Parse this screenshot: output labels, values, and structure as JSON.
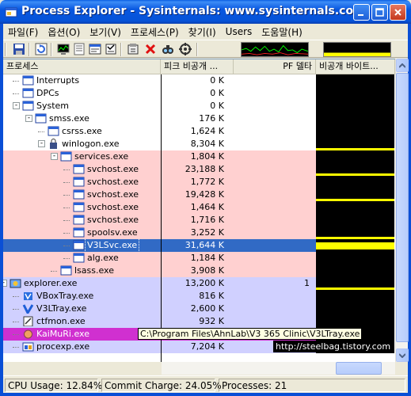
{
  "window": {
    "title": "Process Explorer - Sysinternals: www.sysinternals.co...",
    "colors": {
      "titlebar": "#0857e0",
      "service_row": "#ffd0d0",
      "own_row": "#d0d0ff",
      "selected_row": "#316ac5",
      "highlight_row": "#d030d0",
      "graph_fill": "#ffff00"
    }
  },
  "menu": [
    "파일(F)",
    "옵션(O)",
    "보기(V)",
    "프로세스(P)",
    "찾기(I)",
    "Users",
    "도움말(H)"
  ],
  "toolbar": {
    "icons": [
      "save-icon",
      "refresh-icon",
      "system-info-icon",
      "dll-view-icon",
      "window-icon",
      "properties-icon",
      "target-icon",
      "kill-icon",
      "find-icon",
      "crosshair-icon"
    ]
  },
  "columns": {
    "name": "프로세스",
    "peak": "피크 비공개 ...",
    "pf": "PF 델타",
    "private_graph": "비공개 바이트..."
  },
  "rows": [
    {
      "name": "Interrupts",
      "peak": "0 K",
      "pf": "",
      "level": 1,
      "expander": "",
      "bg": "#ffffff",
      "icon": "window",
      "bar": 0
    },
    {
      "name": "DPCs",
      "peak": "0 K",
      "pf": "",
      "level": 1,
      "expander": "",
      "bg": "#ffffff",
      "icon": "window",
      "bar": 0
    },
    {
      "name": "System",
      "peak": "0 K",
      "pf": "",
      "level": 1,
      "expander": "-",
      "bg": "#ffffff",
      "icon": "window",
      "bar": 0
    },
    {
      "name": "smss.exe",
      "peak": "176 K",
      "pf": "",
      "level": 2,
      "expander": "-",
      "bg": "#ffffff",
      "icon": "window",
      "bar": 0
    },
    {
      "name": "csrss.exe",
      "peak": "1,624 K",
      "pf": "",
      "level": 3,
      "expander": "",
      "bg": "#ffffff",
      "icon": "window",
      "bar": 0
    },
    {
      "name": "winlogon.exe",
      "peak": "8,304 K",
      "pf": "",
      "level": 3,
      "expander": "-",
      "bg": "#ffffff",
      "icon": "lock",
      "bar": 1
    },
    {
      "name": "services.exe",
      "peak": "1,804 K",
      "pf": "",
      "level": 4,
      "expander": "-",
      "bg": "#ffd0d0",
      "icon": "window",
      "bar": 0
    },
    {
      "name": "svchost.exe",
      "peak": "23,188 K",
      "pf": "",
      "level": 5,
      "expander": "",
      "bg": "#ffd0d0",
      "icon": "window",
      "bar": 1
    },
    {
      "name": "svchost.exe",
      "peak": "1,772 K",
      "pf": "",
      "level": 5,
      "expander": "",
      "bg": "#ffd0d0",
      "icon": "window",
      "bar": 0
    },
    {
      "name": "svchost.exe",
      "peak": "19,428 K",
      "pf": "",
      "level": 5,
      "expander": "",
      "bg": "#ffd0d0",
      "icon": "window",
      "bar": 1
    },
    {
      "name": "svchost.exe",
      "peak": "1,464 K",
      "pf": "",
      "level": 5,
      "expander": "",
      "bg": "#ffd0d0",
      "icon": "window",
      "bar": 0
    },
    {
      "name": "svchost.exe",
      "peak": "1,716 K",
      "pf": "",
      "level": 5,
      "expander": "",
      "bg": "#ffd0d0",
      "icon": "window",
      "bar": 0
    },
    {
      "name": "spoolsv.exe",
      "peak": "3,252 K",
      "pf": "",
      "level": 5,
      "expander": "",
      "bg": "#ffd0d0",
      "icon": "window",
      "bar": 1
    },
    {
      "name": "V3LSvc.exe",
      "peak": "31,644 K",
      "pf": "",
      "level": 5,
      "expander": "",
      "bg": "#316ac5",
      "icon": "window",
      "bar": 2,
      "selected": true
    },
    {
      "name": "alg.exe",
      "peak": "1,184 K",
      "pf": "",
      "level": 5,
      "expander": "",
      "bg": "#ffd0d0",
      "icon": "window",
      "bar": 0
    },
    {
      "name": "lsass.exe",
      "peak": "3,908 K",
      "pf": "",
      "level": 4,
      "expander": "",
      "bg": "#ffd0d0",
      "icon": "window",
      "bar": 0
    },
    {
      "name": "explorer.exe",
      "peak": "13,200 K",
      "pf": "1",
      "level": 0,
      "expander": "-",
      "bg": "#d0d0ff",
      "icon": "explorer",
      "bar": 1
    },
    {
      "name": "VBoxTray.exe",
      "peak": "816 K",
      "pf": "",
      "level": 1,
      "expander": "",
      "bg": "#d0d0ff",
      "icon": "vbox",
      "bar": 0
    },
    {
      "name": "V3LTray.exe",
      "peak": "2,600 K",
      "pf": "",
      "level": 1,
      "expander": "",
      "bg": "#d0d0ff",
      "icon": "v3",
      "bar": 0
    },
    {
      "name": "ctfmon.exe",
      "peak": "932 K",
      "pf": "",
      "level": 1,
      "expander": "",
      "bg": "#d0d0ff",
      "icon": "ctf",
      "bar": 0
    },
    {
      "name": "KaiMuRi.exe",
      "peak": "",
      "pf": "",
      "level": 1,
      "expander": "",
      "bg": "#d030d0",
      "icon": "kai",
      "bar": 0
    },
    {
      "name": "procexp.exe",
      "peak": "7,204 K",
      "pf": "",
      "level": 1,
      "expander": "",
      "bg": "#d0d0ff",
      "icon": "procexp",
      "bar": 0
    }
  ],
  "tooltip_path": "C:\\Program Files\\AhnLab\\V3 365 Clinic\\V3LTray.exe",
  "tooltip_url": "http://steelbag.tistory.com",
  "status": {
    "cpu": "CPU Usage: 12.84%",
    "commit": "Commit Charge: 24.05%",
    "processes": "Processes: 21"
  }
}
